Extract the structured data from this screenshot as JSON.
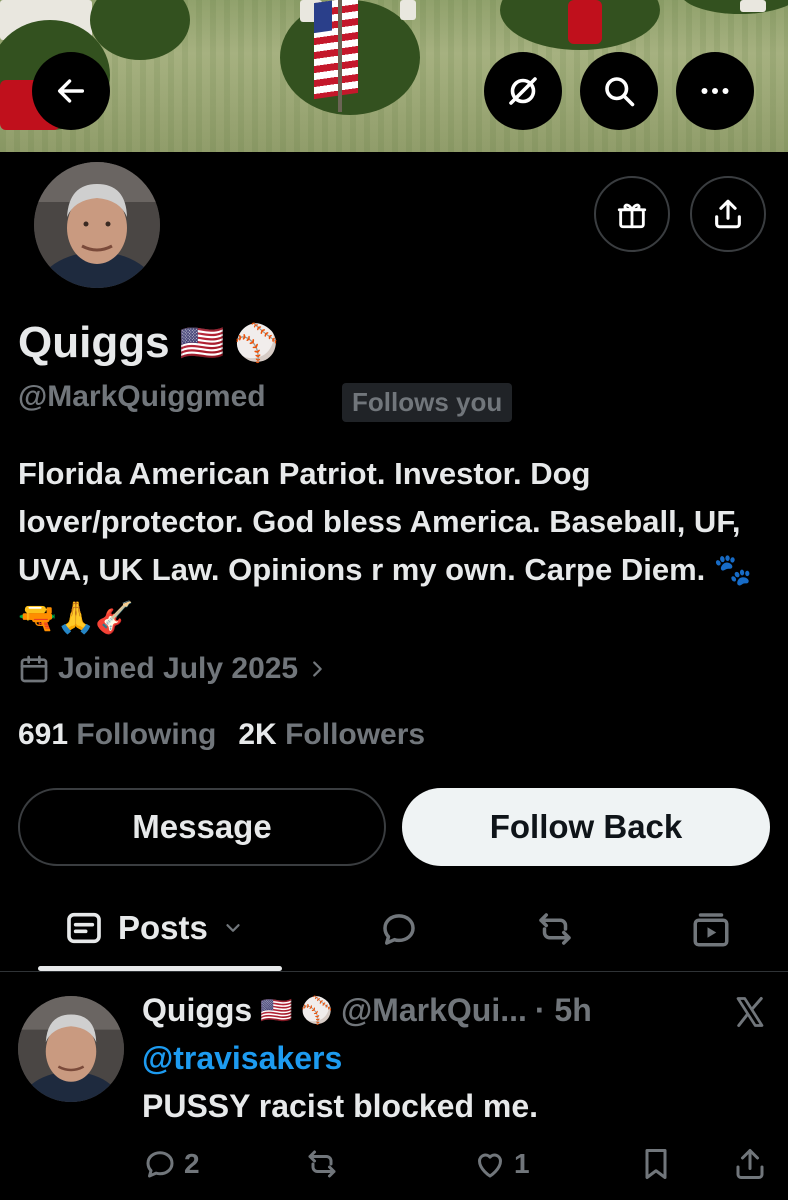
{
  "profile": {
    "display_name": "Quiggs",
    "name_emojis": [
      "🇺🇸",
      "⚾"
    ],
    "handle": "@MarkQuiggmed",
    "follows_you_badge": "Follows you",
    "bio": "Florida American Patriot. Investor. Dog lover/protector. God bless America. Baseball, UF, UVA, UK Law. Opinions r my own. Carpe Diem. 🐾 🔫🙏🎸",
    "joined": "Joined July 2025",
    "following_count": "691",
    "following_label": "Following",
    "followers_count": "2K",
    "followers_label": "Followers"
  },
  "header": {
    "back_icon": "arrow-left-icon",
    "grok_icon": "grok-icon",
    "search_icon": "search-icon",
    "more_icon": "more-icon",
    "gift_icon": "gift-icon",
    "share_icon": "share-icon"
  },
  "buttons": {
    "message": "Message",
    "follow_back": "Follow Back"
  },
  "tabs": {
    "posts_label": "Posts",
    "icons": [
      "posts-icon",
      "chevron-down-icon",
      "replies-icon",
      "repost-icon",
      "media-icon"
    ]
  },
  "post": {
    "author_name": "Quiggs",
    "author_emojis": [
      "🇺🇸",
      "⚾"
    ],
    "author_handle": "@MarkQui...",
    "time": "· 5h",
    "mention": "@travisakers",
    "text": "PUSSY racist blocked me.",
    "reply_count": "2",
    "like_count": "1",
    "source_icon": "x-logo-icon"
  },
  "colors": {
    "background": "#000000",
    "text_primary": "#e7e9ea",
    "text_secondary": "#71767b",
    "link": "#1d9bf0",
    "follow_button_bg": "#eff3f4"
  }
}
